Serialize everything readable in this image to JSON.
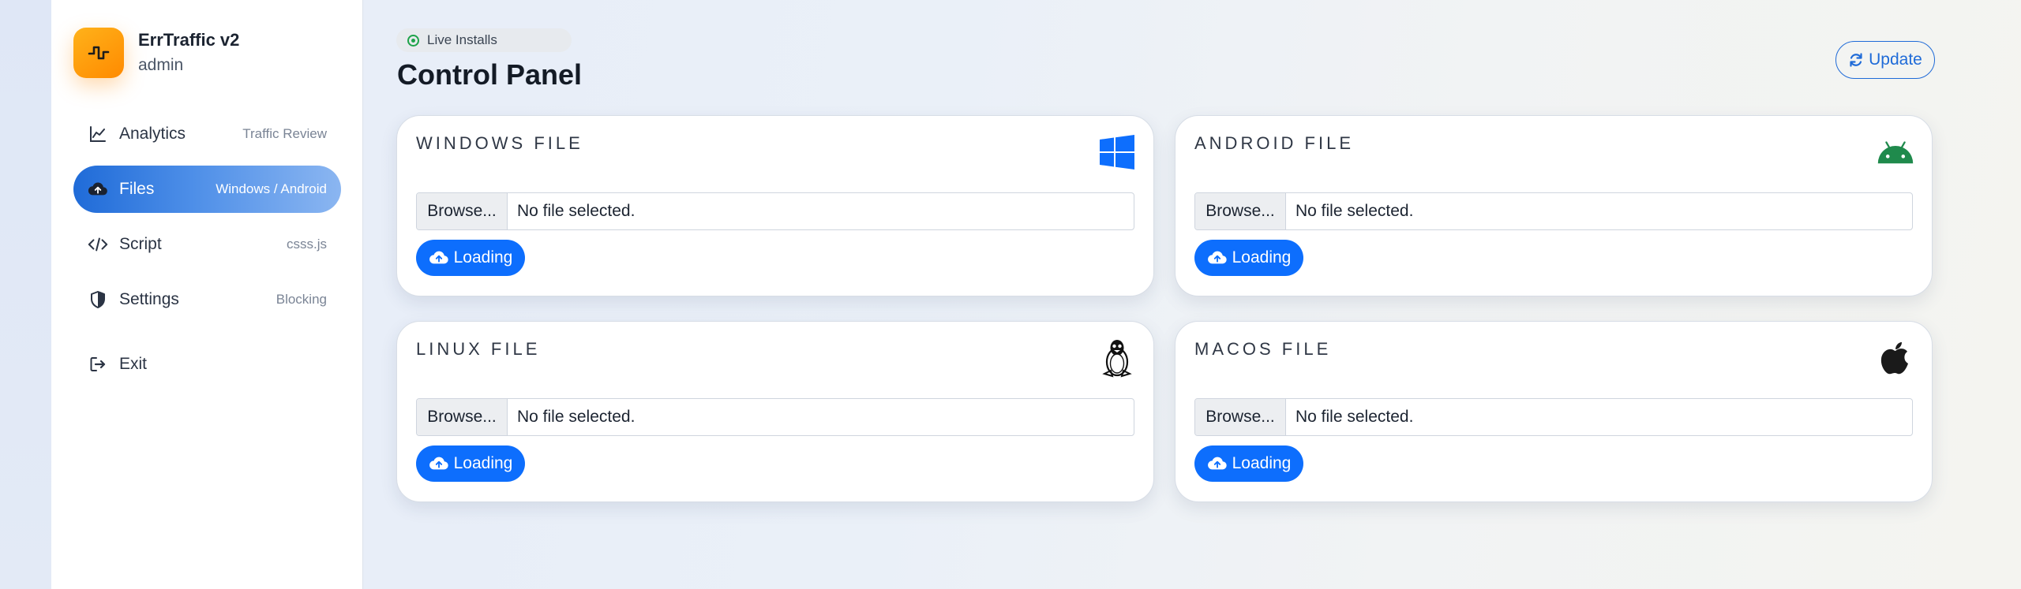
{
  "app": {
    "title": "ErrTraffic v2",
    "user": "admin"
  },
  "sidebar": {
    "items": [
      {
        "label": "Analytics",
        "hint": "Traffic Review",
        "icon": "chart-line-icon"
      },
      {
        "label": "Files",
        "hint": "Windows / Android",
        "icon": "cloud-upload-icon",
        "active": true
      },
      {
        "label": "Script",
        "hint": "csss.js",
        "icon": "code-icon"
      },
      {
        "label": "Settings",
        "hint": "Blocking",
        "icon": "shield-icon"
      }
    ],
    "exit_label": "Exit"
  },
  "header": {
    "badge": "Live Installs",
    "title": "Control Panel",
    "update_label": "Update"
  },
  "cards": [
    {
      "title": "WINDOWS FILE",
      "icon": "windows-icon",
      "browse": "Browse...",
      "status": "No file selected.",
      "button": "Loading"
    },
    {
      "title": "ANDROID FILE",
      "icon": "android-icon",
      "browse": "Browse...",
      "status": "No file selected.",
      "button": "Loading"
    },
    {
      "title": "LINUX FILE",
      "icon": "linux-icon",
      "browse": "Browse...",
      "status": "No file selected.",
      "button": "Loading"
    },
    {
      "title": "MACOS FILE",
      "icon": "apple-icon",
      "browse": "Browse...",
      "status": "No file selected.",
      "button": "Loading"
    }
  ],
  "colors": {
    "accent": "#0d6efd",
    "brand": "#ff9a0a",
    "live": "#1ea34a",
    "android": "#1f8a4c"
  }
}
